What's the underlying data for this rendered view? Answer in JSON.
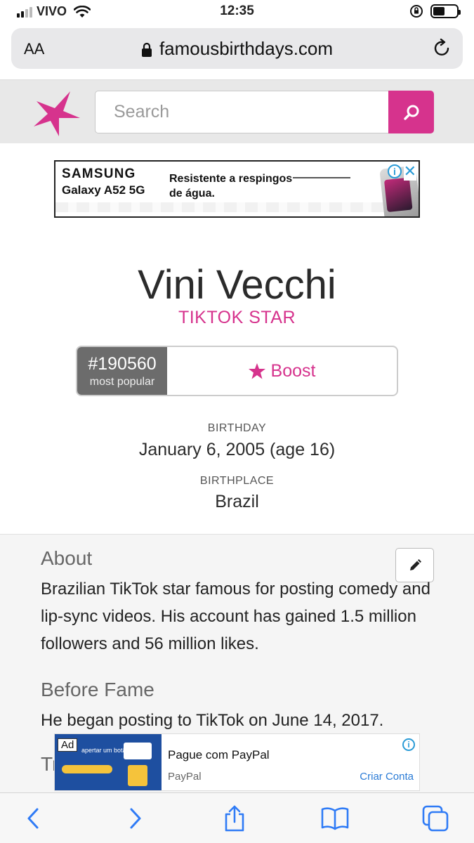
{
  "status_bar": {
    "carrier": "VIVO",
    "time": "12:35"
  },
  "browser": {
    "aa_label": "AA",
    "url": "famousbirthdays.com"
  },
  "site": {
    "search_placeholder": "Search",
    "brand_color": "#d6338d"
  },
  "ad_top": {
    "brand": "SAMSUNG",
    "model": "Galaxy A52 5G",
    "tagline": "Resistente a respingos de água."
  },
  "profile": {
    "name": "Vini Vecchi",
    "occupation": "TIKTOK STAR",
    "rank": "#190560",
    "rank_label": "most popular",
    "boost_label": "Boost",
    "birthday_label": "BIRTHDAY",
    "birthday_value": "January 6, 2005 (age 16)",
    "birthplace_label": "BIRTHPLACE",
    "birthplace_value": "Brazil"
  },
  "about": {
    "title": "About",
    "text": "Brazilian TikTok star famous for posting comedy and lip-sync videos. His account has gained 1.5 million followers and 56 million likes.",
    "before_fame_title": "Before Fame",
    "before_fame_text": "He began posting to TikTok on June 14, 2017.",
    "partial_heading": "Tr"
  },
  "ad_bottom": {
    "ad_tag": "Ad",
    "image_text": "apertar um botão.",
    "title": "Pague com PayPal",
    "advertiser": "PayPal",
    "cta": "Criar Conta"
  }
}
